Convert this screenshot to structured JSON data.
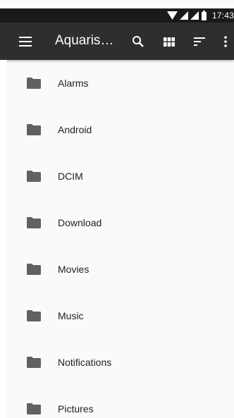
{
  "status_bar": {
    "time": "17:43",
    "icons": [
      "wifi-icon",
      "signal-icon",
      "signal-icon",
      "battery-icon"
    ]
  },
  "app_bar": {
    "title": "Aquaris…",
    "menu_icon": "menu-icon",
    "actions": [
      "search-icon",
      "grid-view-icon",
      "sort-icon",
      "more-vert-icon"
    ]
  },
  "folders": [
    {
      "label": "Alarms"
    },
    {
      "label": "Android"
    },
    {
      "label": "DCIM"
    },
    {
      "label": "Download"
    },
    {
      "label": "Movies"
    },
    {
      "label": "Music"
    },
    {
      "label": "Notifications"
    },
    {
      "label": "Pictures"
    }
  ],
  "colors": {
    "status_bar": "#1a1a1a",
    "app_bar": "#2e2e2e",
    "folder_icon": "#616161",
    "text": "#212121",
    "background": "#fafafa"
  }
}
